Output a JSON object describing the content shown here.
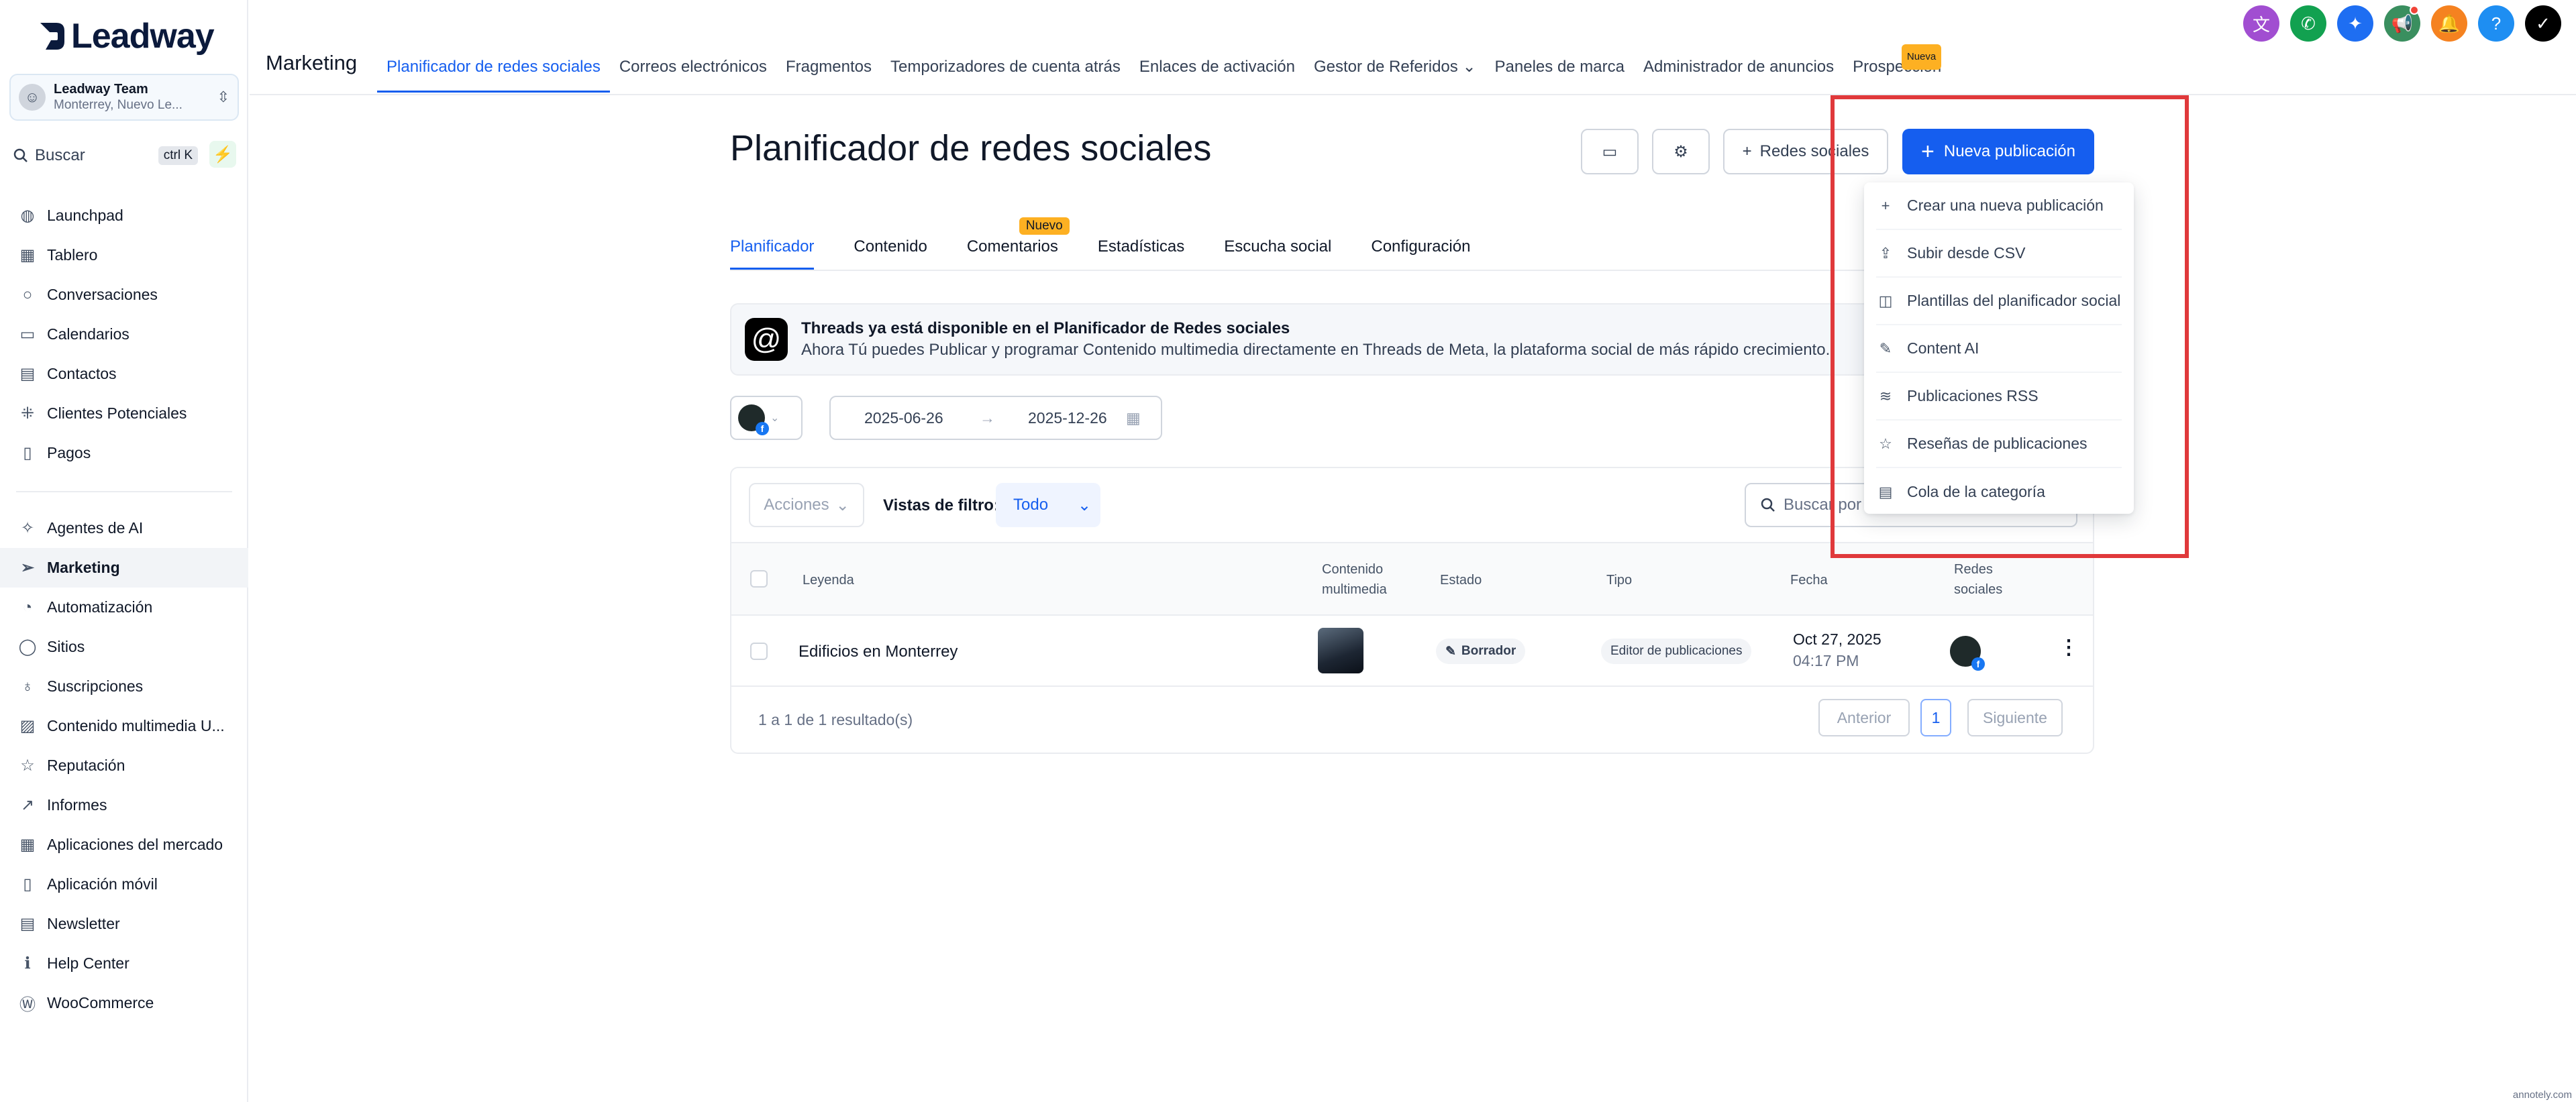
{
  "sidebar": {
    "brand": "Leadway",
    "location": {
      "name": "Leadway Team",
      "sub": "Monterrey, Nuevo Le..."
    },
    "search": {
      "label": "Buscar",
      "shortcut": "ctrl K"
    },
    "items_top": [
      {
        "label": "Launchpad",
        "icon": "rocket-icon",
        "glyph": "◍"
      },
      {
        "label": "Tablero",
        "icon": "dashboard-icon",
        "glyph": "▦"
      },
      {
        "label": "Conversaciones",
        "icon": "chat-icon",
        "glyph": "○"
      },
      {
        "label": "Calendarios",
        "icon": "calendar-icon",
        "glyph": "▭"
      },
      {
        "label": "Contactos",
        "icon": "contacts-icon",
        "glyph": "▤"
      },
      {
        "label": "Clientes Potenciales",
        "icon": "pipeline-icon",
        "glyph": "⁜"
      },
      {
        "label": "Pagos",
        "icon": "payments-icon",
        "glyph": "▯"
      }
    ],
    "items_bottom": [
      {
        "label": "Agentes de AI",
        "icon": "sparkle-icon",
        "glyph": "✧"
      },
      {
        "label": "Marketing",
        "icon": "send-icon",
        "glyph": "➢",
        "active": true
      },
      {
        "label": "Automatización",
        "icon": "automation-icon",
        "glyph": "◔"
      },
      {
        "label": "Sitios",
        "icon": "globe-icon",
        "glyph": "◯"
      },
      {
        "label": "Suscripciones",
        "icon": "badge-icon",
        "glyph": "♁"
      },
      {
        "label": "Contenido multimedia U...",
        "icon": "media-icon",
        "glyph": "▨"
      },
      {
        "label": "Reputación",
        "icon": "star-icon",
        "glyph": "☆"
      },
      {
        "label": "Informes",
        "icon": "chart-icon",
        "glyph": "↗"
      },
      {
        "label": "Aplicaciones del mercado",
        "icon": "apps-icon",
        "glyph": "▦"
      },
      {
        "label": "Aplicación móvil",
        "icon": "mobile-icon",
        "glyph": "▯"
      },
      {
        "label": "Newsletter",
        "icon": "newsletter-icon",
        "glyph": "▤"
      },
      {
        "label": "Help Center",
        "icon": "info-icon",
        "glyph": "ℹ"
      },
      {
        "label": "WooCommerce",
        "icon": "woocommerce-icon",
        "glyph": "Ⓦ"
      }
    ]
  },
  "topbar": {
    "title": "Marketing",
    "tabs": [
      {
        "label": "Planificador de redes sociales",
        "active": true
      },
      {
        "label": "Correos electrónicos"
      },
      {
        "label": "Fragmentos"
      },
      {
        "label": "Temporizadores de cuenta atrás"
      },
      {
        "label": "Enlaces de activación"
      },
      {
        "label": "Gestor de Referidos ⌄"
      },
      {
        "label": "Paneles de marca"
      },
      {
        "label": "Administrador de anuncios"
      },
      {
        "label": "Prospección",
        "badge": "Nueva"
      }
    ],
    "icons": [
      {
        "name": "translate-icon",
        "glyph": "文",
        "color": "#a14ed1"
      },
      {
        "name": "phone-icon",
        "glyph": "✆",
        "color": "#12a150"
      },
      {
        "name": "magic-icon",
        "glyph": "✦",
        "color": "#1e6ef2"
      },
      {
        "name": "megaphone-icon",
        "glyph": "📢",
        "color": "#3a8f5f",
        "dot": true
      },
      {
        "name": "bell-icon",
        "glyph": "🔔",
        "color": "#f58220"
      },
      {
        "name": "help-icon",
        "glyph": "?",
        "color": "#1e8ef2"
      },
      {
        "name": "profile-icon",
        "glyph": "✓",
        "color": "#000000"
      }
    ]
  },
  "page": {
    "title": "Planificador de redes sociales",
    "redes_btn": "Redes sociales",
    "new_btn": "Nueva publicación",
    "subtabs": [
      {
        "label": "Planificador",
        "active": true
      },
      {
        "label": "Contenido"
      },
      {
        "label": "Comentarios",
        "badge": "Nuevo"
      },
      {
        "label": "Estadísticas"
      },
      {
        "label": "Escucha social"
      },
      {
        "label": "Configuración"
      }
    ],
    "banner": {
      "title": "Threads ya está disponible en el Planificador de Redes sociales",
      "text": "Ahora Tú puedes Publicar y programar Contenido multimedia directamente en Threads de Meta, la plataforma social de más rápido crecimiento."
    },
    "date_from": "2025-06-26",
    "date_to": "2025-12-26",
    "filters": {
      "actions": "Acciones",
      "views_label": "Vistas de filtro:",
      "views_value": "Todo",
      "search_placeholder": "Buscar por"
    },
    "columns": {
      "caption": "Leyenda",
      "media": "Contenido multimedia",
      "status": "Estado",
      "type": "Tipo",
      "date": "Fecha",
      "networks": "Redes sociales"
    },
    "row": {
      "caption": "Edificios en Monterrey",
      "status": "Borrador",
      "type": "Editor de publicaciones",
      "date": "Oct 27, 2025",
      "time": "04:17 PM"
    },
    "footer": {
      "count": "1 a 1 de 1 resultado(s)",
      "prev": "Anterior",
      "page": "1",
      "next": "Siguiente"
    }
  },
  "dropdown": [
    {
      "label": "Crear una nueva publicación",
      "icon": "plus-icon",
      "glyph": "+"
    },
    {
      "label": "Subir desde CSV",
      "icon": "upload-icon",
      "glyph": "⇪"
    },
    {
      "label": "Plantillas del planificador social",
      "icon": "template-icon",
      "glyph": "◫"
    },
    {
      "label": "Content AI",
      "icon": "ai-icon",
      "glyph": "✎"
    },
    {
      "label": "Publicaciones RSS",
      "icon": "rss-icon",
      "glyph": "≋"
    },
    {
      "label": "Reseñas de publicaciones",
      "icon": "star-outline-icon",
      "glyph": "☆"
    },
    {
      "label": "Cola de la categoría",
      "icon": "queue-icon",
      "glyph": "▤"
    }
  ],
  "watermark": "annotely.com",
  "colors": {
    "primary": "#155eef",
    "highlight": "#e0393b",
    "badge": "#fdb022"
  }
}
